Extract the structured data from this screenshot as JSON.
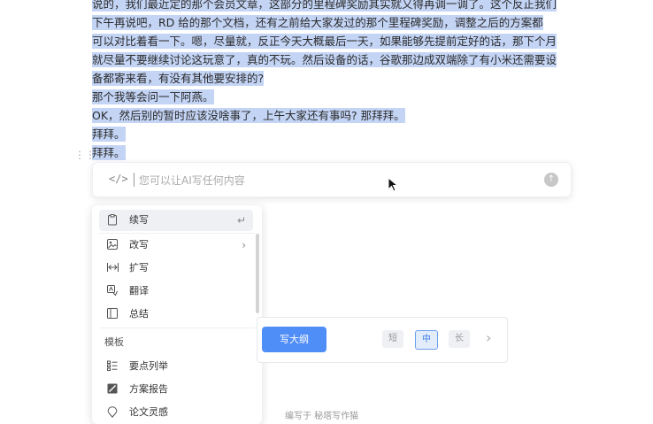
{
  "document": {
    "lines": [
      "说的，我们最近定的那个会员文章，这部分的里程碑奖励其实就又得再调一调了。这个反正我们",
      "下午再说吧，RD 给的那个文档，还有之前给大家发过的那个里程碑奖励，调整之后的方案都",
      "可以对比着看一下。嗯，尽量就，反正今天大概最后一天，如果能够先提前定好的话，那下个月",
      "就尽量不要继续讨论这玩意了，真的不玩。然后设备的话，谷歌那边成双端除了有小米还需要设",
      "备都寄来看，有没有其他要安排的?",
      "那个我等会问一下阿燕。",
      "OK，然后别的暂时应该没啥事了，上午大家还有事吗? 那拜拜。",
      "拜拜。",
      "拜拜。"
    ]
  },
  "ai_bar": {
    "placeholder": "您可以让AI写任何内容",
    "code_icon": "</>"
  },
  "menu": {
    "items": [
      {
        "label": "续写",
        "icon": "clipboard-icon"
      },
      {
        "label": "改写",
        "icon": "image-edit-icon"
      },
      {
        "label": "扩写",
        "icon": "expand-icon"
      },
      {
        "label": "翻译",
        "icon": "translate-icon"
      },
      {
        "label": "总结",
        "icon": "summary-icon"
      }
    ],
    "section_label": "模板",
    "templates": [
      {
        "label": "要点列举",
        "icon": "list-icon"
      },
      {
        "label": "方案报告",
        "icon": "report-icon"
      },
      {
        "label": "论文灵感",
        "icon": "bulb-icon"
      }
    ]
  },
  "panel": {
    "outline_button": "写大纲",
    "length_short": "短",
    "length_mid": "中",
    "length_long": "长"
  },
  "footer": {
    "text": "编写于 秘塔写作猫"
  }
}
